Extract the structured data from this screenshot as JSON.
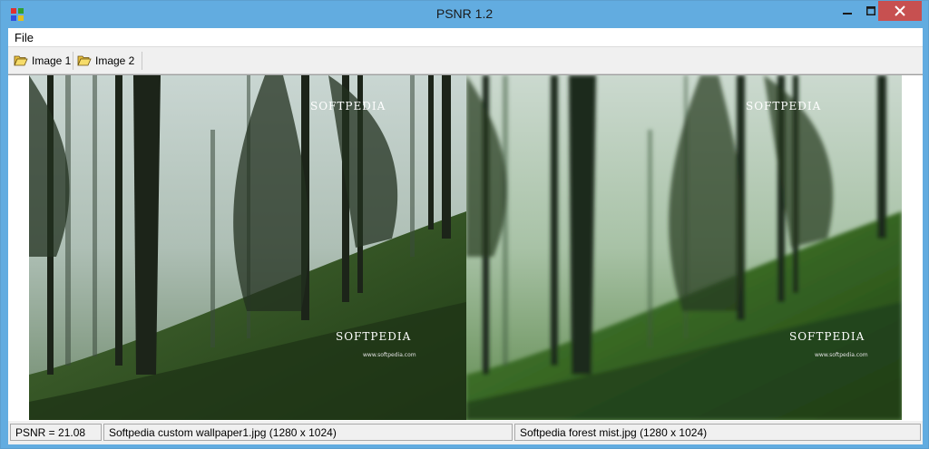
{
  "window": {
    "title": "PSNR 1.2",
    "accent": "#62ace0",
    "close_color": "#c75050"
  },
  "menu": {
    "items": [
      {
        "label": "File"
      }
    ]
  },
  "toolbar": {
    "buttons": [
      {
        "label": "Image 1",
        "icon": "open-folder-icon"
      },
      {
        "label": "Image 2",
        "icon": "open-folder-icon"
      }
    ]
  },
  "images": {
    "left_watermark": "SOFTPEDIA",
    "left_watermark_2": "SOFTPEDIA",
    "left_url": "www.softpedia.com",
    "right_watermark": "SOFTPEDIA",
    "right_watermark_2": "SOFTPEDIA",
    "right_url": "www.softpedia.com"
  },
  "status": {
    "psnr": "PSNR = 21.08",
    "image1": "Softpedia custom wallpaper1.jpg (1280 x 1024)",
    "image2": "Softpedia forest mist.jpg (1280 x 1024)"
  }
}
